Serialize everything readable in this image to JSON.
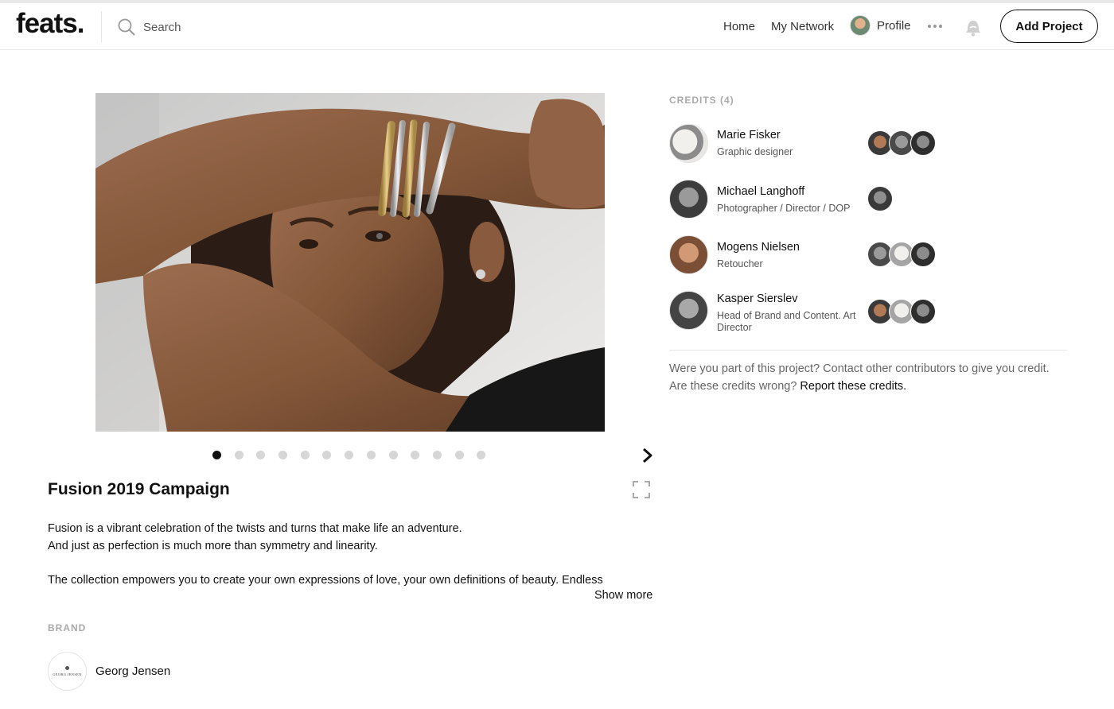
{
  "nav": {
    "logo": "feats.",
    "search_placeholder": "Search",
    "home": "Home",
    "my_network": "My Network",
    "profile": "Profile",
    "add_project": "Add Project"
  },
  "carousel": {
    "slide_count": 13,
    "active_index": 0
  },
  "project": {
    "title": "Fusion 2019 Campaign",
    "description_lines": [
      "Fusion is a vibrant celebration of the twists and turns that make life an adventure.",
      "And just as perfection is much more than symmetry and linearity.",
      "The collection empowers you to create your own expressions of love, your own definitions of beauty. Endless"
    ],
    "show_more": "Show more"
  },
  "brand": {
    "heading": "BRAND",
    "name": "Georg Jensen",
    "logo_text": "GEORG JENSEN"
  },
  "credits": {
    "heading": "CREDITS (4)",
    "people": [
      {
        "name": "Marie Fisker",
        "role": "Graphic designer",
        "collaborators": 3
      },
      {
        "name": "Michael Langhoff",
        "role": "Photographer / Director / DOP",
        "collaborators": 1
      },
      {
        "name": "Mogens Nielsen",
        "role": "Retoucher",
        "collaborators": 3
      },
      {
        "name": "Kasper Sierslev",
        "role": "Head of Brand and Content. Art Director",
        "collaborators": 3
      }
    ],
    "note_line1": "Were you part of this project? Contact other contributors to give you credit.",
    "note_line2": "Are these credits wrong?",
    "report_link": "Report these credits."
  },
  "colors": {
    "text": "#111111",
    "muted": "#aaaaaa",
    "dot_inactive": "#d6d6d6"
  },
  "icons": [
    "search-icon",
    "more-icon",
    "bell-icon",
    "chevron-right-icon",
    "expand-icon"
  ]
}
